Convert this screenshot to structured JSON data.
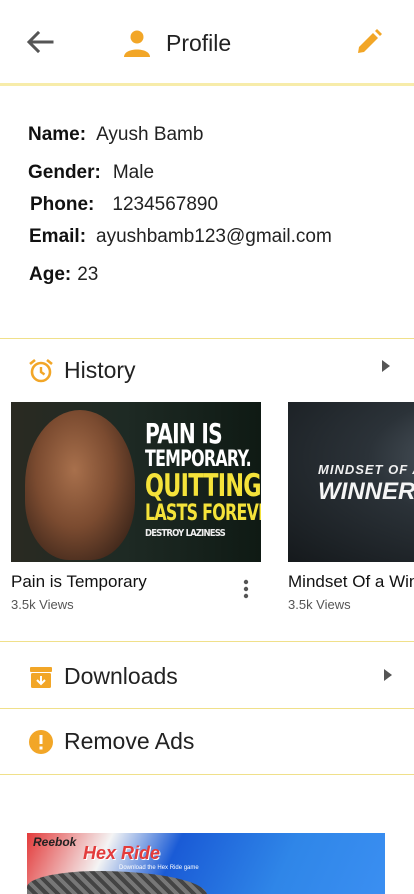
{
  "app_bar": {
    "title": "Profile"
  },
  "profile": {
    "name_label": "Name:",
    "name": "Ayush Bamb",
    "gender_label": "Gender:",
    "gender": "Male",
    "phone_label": "Phone:",
    "phone": "1234567890",
    "email_label": "Email:",
    "email": "ayushbamb123@gmail.com",
    "age_label": "Age:",
    "age": "23"
  },
  "history": {
    "label": "History",
    "items": [
      {
        "title": "Pain is Temporary",
        "views": "3.5k Views",
        "thumb_lines": [
          "PAIN IS",
          "TEMPORARY.",
          "QUITTING",
          "LASTS FOREVER.",
          "DESTROY LAZINESS"
        ]
      },
      {
        "title": "Mindset Of a Winner",
        "views": "3.5k Views",
        "thumb_lines": [
          "MINDSET OF A",
          "WINNER"
        ]
      }
    ]
  },
  "downloads": {
    "label": "Downloads"
  },
  "remove_ads": {
    "label": "Remove Ads"
  },
  "ad_banner": {
    "brand": "Reebok",
    "headline": "Hex Ride",
    "subtext": "Download the Hex Ride game"
  },
  "colors": {
    "accent": "#f2a627",
    "divider": "#f0e08a",
    "yellow_text": "#f5e33a"
  }
}
